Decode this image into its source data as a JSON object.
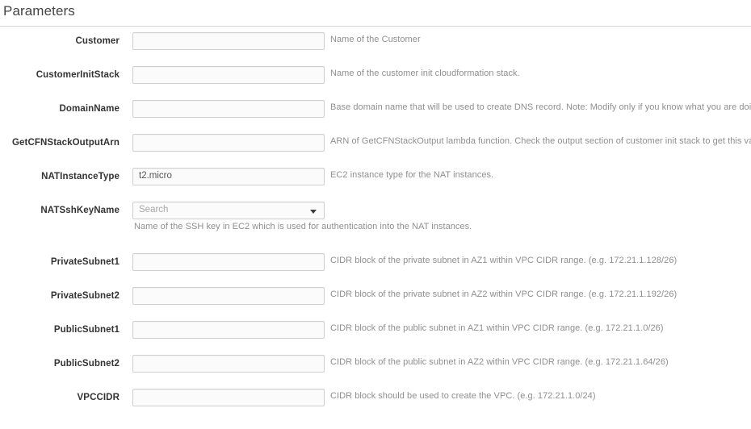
{
  "section": {
    "title": "Parameters"
  },
  "form": {
    "rows": [
      {
        "label": "Customer",
        "control": "text",
        "value": "",
        "placeholder": "",
        "description": "Name of the Customer",
        "sub_description": ""
      },
      {
        "label": "CustomerInitStack",
        "control": "text",
        "value": "",
        "placeholder": "",
        "description": "Name of the customer init cloudformation stack.",
        "sub_description": ""
      },
      {
        "label": "DomainName",
        "control": "text",
        "value": "",
        "placeholder": "",
        "description": "Base domain name that will be used to create DNS record. Note: Modify only if you know what you are doing.",
        "sub_description": ""
      },
      {
        "label": "GetCFNStackOutputArn",
        "control": "text",
        "value": "",
        "placeholder": "",
        "description": "ARN of GetCFNStackOutput lambda function. Check the output section of customer init stack to get this value.",
        "sub_description": ""
      },
      {
        "label": "NATInstanceType",
        "control": "text",
        "value": "t2.micro",
        "placeholder": "",
        "description": "EC2 instance type for the NAT instances.",
        "sub_description": ""
      },
      {
        "label": "NATSshKeyName",
        "control": "select",
        "value": "",
        "placeholder": "Search",
        "description": "",
        "sub_description": "Name of the SSH key in EC2 which is used for authentication into the NAT instances.",
        "icon": "chevron-down-icon"
      },
      {
        "label": "PrivateSubnet1",
        "control": "text",
        "value": "",
        "placeholder": "",
        "description": "CIDR block of the private subnet in AZ1 within VPC CIDR range. (e.g. 172.21.1.128/26)",
        "sub_description": ""
      },
      {
        "label": "PrivateSubnet2",
        "control": "text",
        "value": "",
        "placeholder": "",
        "description": "CIDR block of the private subnet in AZ2 within VPC CIDR range. (e.g. 172.21.1.192/26)",
        "sub_description": ""
      },
      {
        "label": "PublicSubnet1",
        "control": "text",
        "value": "",
        "placeholder": "",
        "description": "CIDR block of the public subnet in AZ1 within VPC CIDR range. (e.g. 172.21.1.0/26)",
        "sub_description": ""
      },
      {
        "label": "PublicSubnet2",
        "control": "text",
        "value": "",
        "placeholder": "",
        "description": "CIDR block of the public subnet in AZ2 within VPC CIDR range. (e.g. 172.21.1.64/26)",
        "sub_description": ""
      },
      {
        "label": "VPCCIDR",
        "control": "text",
        "value": "",
        "placeholder": "",
        "description": "CIDR block should be used to create the VPC. (e.g. 172.21.1.0/24)",
        "sub_description": ""
      }
    ]
  },
  "colors": {
    "text": "#333333",
    "muted": "#8f8f8f",
    "border": "#cfcfcf",
    "rule": "#d6d6d6",
    "field_bg": "#fbfbfb",
    "placeholder": "#a6a6a6"
  }
}
